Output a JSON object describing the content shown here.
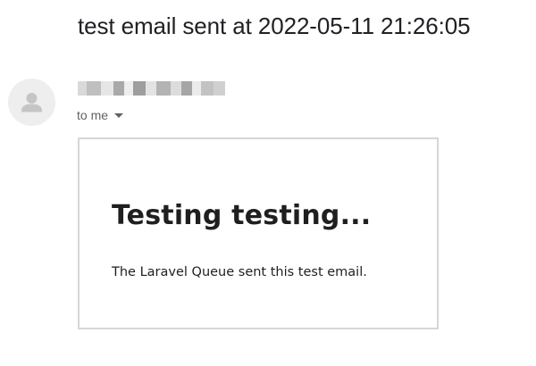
{
  "email": {
    "subject": "test email sent at 2022-05-11 21:26:05",
    "sender_name": "",
    "recipient_label": "to me",
    "body": {
      "heading": "Testing testing...",
      "text": "The Laravel Queue sent this test email."
    }
  },
  "icons": {
    "avatar": "default-person-icon",
    "recipient_toggle": "chevron-down-icon"
  },
  "colors": {
    "avatar_bg": "#eeeeee",
    "avatar_icon": "#c5c5c5",
    "card_border": "#d6d6d6",
    "text_primary": "#202124",
    "text_secondary": "#5f6368"
  }
}
